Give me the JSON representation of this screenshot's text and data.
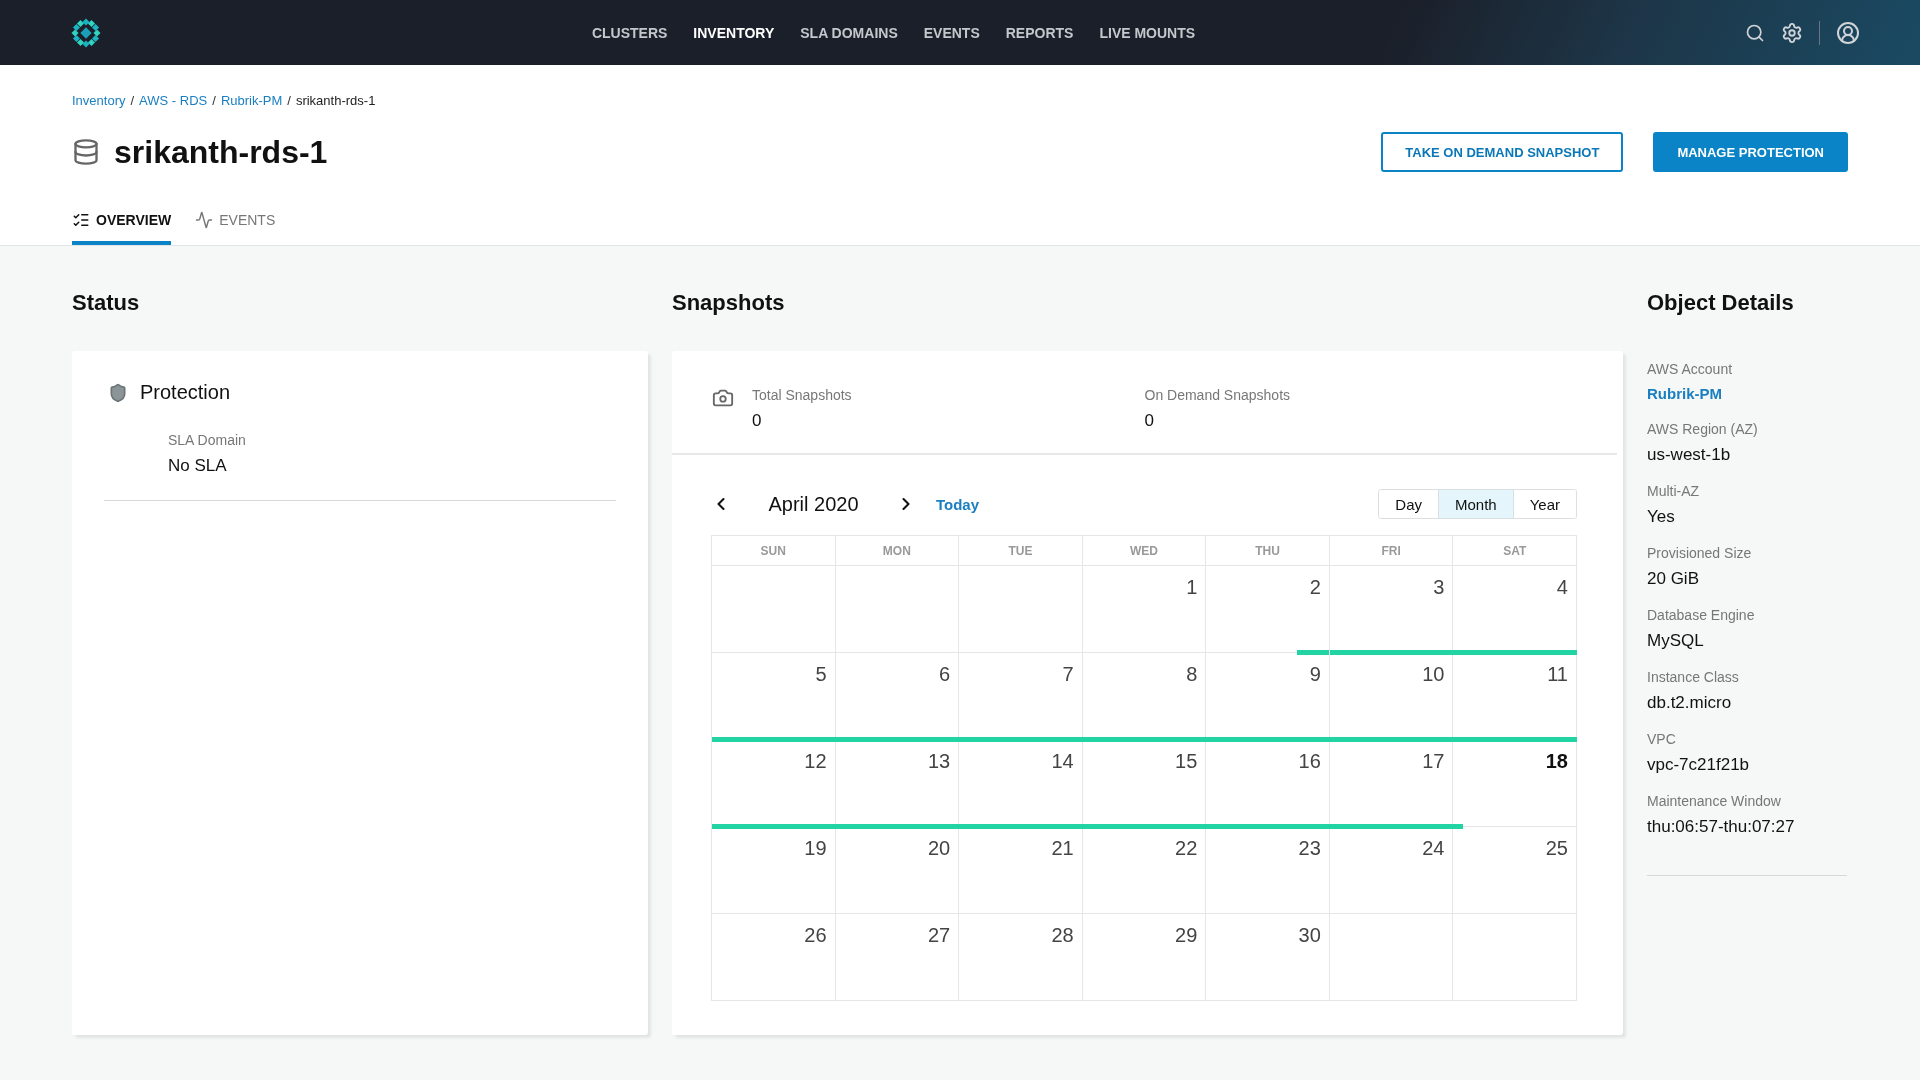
{
  "nav": {
    "items": [
      {
        "label": "CLUSTERS",
        "selected": false
      },
      {
        "label": "INVENTORY",
        "selected": true
      },
      {
        "label": "SLA DOMAINS",
        "selected": false
      },
      {
        "label": "EVENTS",
        "selected": false
      },
      {
        "label": "REPORTS",
        "selected": false
      },
      {
        "label": "LIVE MOUNTS",
        "selected": false
      }
    ]
  },
  "breadcrumb": [
    {
      "label": "Inventory",
      "kind": "link"
    },
    {
      "label": "AWS - RDS",
      "kind": "link",
      "separator": "/"
    },
    {
      "label": "Rubrik-PM",
      "kind": "link",
      "separator": "/"
    },
    {
      "label": "srikanth-rds-1",
      "kind": "current",
      "separator": "/"
    }
  ],
  "title": "srikanth-rds-1",
  "actions": [
    {
      "label": "TAKE ON DEMAND SNAPSHOT",
      "kind": "outline"
    },
    {
      "label": "MANAGE PROTECTION",
      "kind": "primary"
    }
  ],
  "tabs": [
    {
      "label": "OVERVIEW",
      "selected": true
    },
    {
      "label": "EVENTS",
      "selected": false
    }
  ],
  "status": {
    "heading": "Status",
    "card": {
      "title": "Protection",
      "fields": [
        {
          "label": "SLA Domain",
          "value": "No SLA"
        }
      ]
    }
  },
  "snapshots": {
    "heading": "Snapshots",
    "stats": [
      {
        "label": "Total Snapshots",
        "value": "0"
      },
      {
        "label": "On Demand Snapshots",
        "value": "0"
      }
    ],
    "calendar": {
      "month_label": "April 2020",
      "today_label": "Today",
      "views": [
        {
          "label": "Day",
          "selected": false
        },
        {
          "label": "Month",
          "selected": true
        },
        {
          "label": "Year",
          "selected": false
        }
      ],
      "weekdays": [
        "SUN",
        "MON",
        "TUE",
        "WED",
        "THU",
        "FRI",
        "SAT"
      ],
      "weeks": [
        [
          {
            "kind": "blank"
          },
          {
            "kind": "blank"
          },
          {
            "kind": "blank"
          },
          {
            "kind": "day",
            "day": "1",
            "today": false
          },
          {
            "kind": "day",
            "day": "2",
            "today": false,
            "level": 0.25,
            "bar_at_end": true
          },
          {
            "kind": "day",
            "day": "3",
            "today": false,
            "level": 1,
            "bar_at_end": false
          },
          {
            "kind": "day",
            "day": "4",
            "today": false,
            "level": 1,
            "bar_at_end": false
          }
        ],
        [
          {
            "kind": "day",
            "day": "5",
            "today": false,
            "level": 1,
            "bar_at_end": false
          },
          {
            "kind": "day",
            "day": "6",
            "today": false,
            "level": 1,
            "bar_at_end": false
          },
          {
            "kind": "day",
            "day": "7",
            "today": false,
            "level": 1,
            "bar_at_end": false
          },
          {
            "kind": "day",
            "day": "8",
            "today": false,
            "level": 1,
            "bar_at_end": false
          },
          {
            "kind": "day",
            "day": "9",
            "today": false,
            "level": 1,
            "bar_at_end": false
          },
          {
            "kind": "day",
            "day": "10",
            "today": false,
            "level": 1,
            "bar_at_end": false
          },
          {
            "kind": "day",
            "day": "11",
            "today": false,
            "level": 1,
            "bar_at_end": false
          }
        ],
        [
          {
            "kind": "day",
            "day": "12",
            "today": false,
            "level": 1,
            "bar_at_end": false
          },
          {
            "kind": "day",
            "day": "13",
            "today": false,
            "level": 1,
            "bar_at_end": false
          },
          {
            "kind": "day",
            "day": "14",
            "today": false,
            "level": 1,
            "bar_at_end": false
          },
          {
            "kind": "day",
            "day": "15",
            "today": false,
            "level": 1,
            "bar_at_end": false
          },
          {
            "kind": "day",
            "day": "16",
            "today": false,
            "level": 1,
            "bar_at_end": false
          },
          {
            "kind": "day",
            "day": "17",
            "today": false,
            "level": 1,
            "bar_at_end": false
          },
          {
            "kind": "day",
            "day": "18",
            "today": true,
            "level": 0.07,
            "bar_at_end": false
          }
        ],
        [
          {
            "kind": "day",
            "day": "19",
            "today": false
          },
          {
            "kind": "day",
            "day": "20",
            "today": false
          },
          {
            "kind": "day",
            "day": "21",
            "today": false
          },
          {
            "kind": "day",
            "day": "22",
            "today": false
          },
          {
            "kind": "day",
            "day": "23",
            "today": false
          },
          {
            "kind": "day",
            "day": "24",
            "today": false
          },
          {
            "kind": "day",
            "day": "25",
            "today": false
          }
        ],
        [
          {
            "kind": "day",
            "day": "26",
            "today": false
          },
          {
            "kind": "day",
            "day": "27",
            "today": false
          },
          {
            "kind": "day",
            "day": "28",
            "today": false
          },
          {
            "kind": "day",
            "day": "29",
            "today": false
          },
          {
            "kind": "day",
            "day": "30",
            "today": false
          },
          {
            "kind": "blank"
          },
          {
            "kind": "blank"
          }
        ]
      ]
    }
  },
  "details": {
    "heading": "Object Details",
    "fields": [
      {
        "label": "AWS Account",
        "value": "Rubrik-PM",
        "kind": "link"
      },
      {
        "label": "AWS Region (AZ)",
        "value": "us-west-1b",
        "kind": "text"
      },
      {
        "label": "Multi-AZ",
        "value": "Yes",
        "kind": "text"
      },
      {
        "label": "Provisioned Size",
        "value": "20 GiB",
        "kind": "text"
      },
      {
        "label": "Database Engine",
        "value": "MySQL",
        "kind": "text"
      },
      {
        "label": "Instance Class",
        "value": "db.t2.micro",
        "kind": "text"
      },
      {
        "label": "VPC",
        "value": "vpc-7c21f21b",
        "kind": "text"
      },
      {
        "label": "Maintenance Window",
        "value": "thu:06:57-thu:07:27",
        "kind": "text"
      }
    ]
  }
}
